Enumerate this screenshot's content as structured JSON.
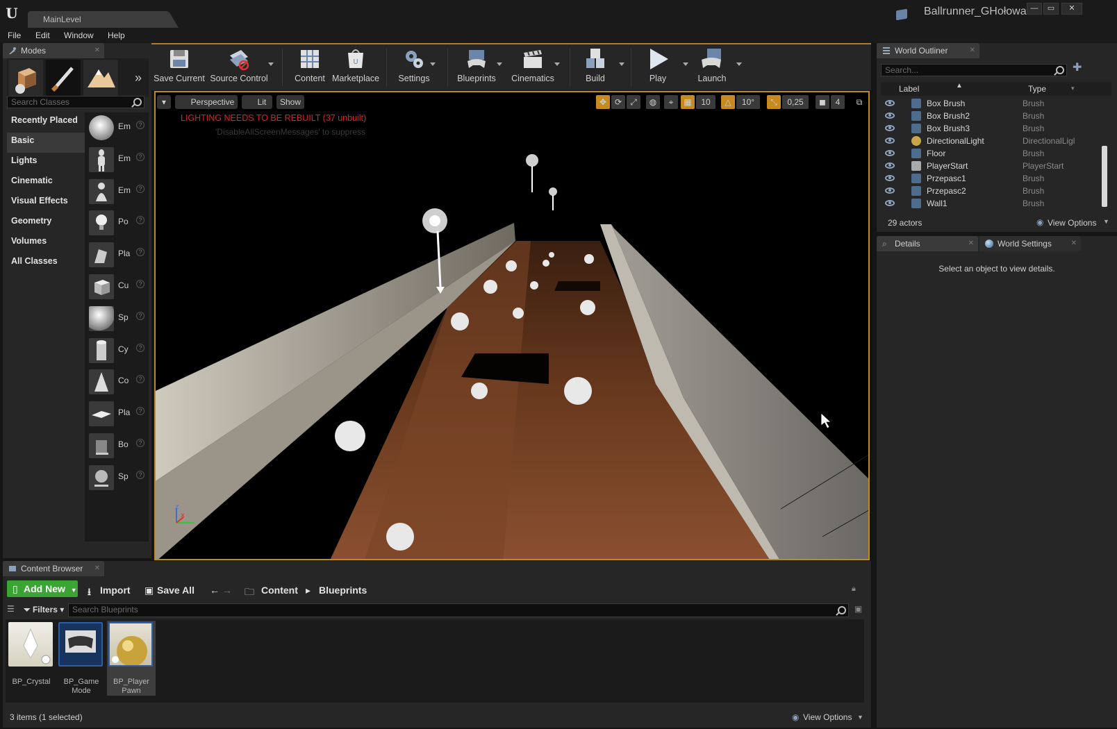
{
  "window": {
    "level_tab": "MainLevel",
    "project_name": "Ballrunner_GHołowacz",
    "controls": [
      "—",
      "▭",
      "✕"
    ]
  },
  "menu": [
    "File",
    "Edit",
    "Window",
    "Help"
  ],
  "modes": {
    "title": "Modes",
    "search_placeholder": "Search Classes",
    "categories": [
      "Recently Placed",
      "Basic",
      "Lights",
      "Cinematic",
      "Visual Effects",
      "Geometry",
      "Volumes",
      "All Classes"
    ],
    "active_category": "Basic",
    "items": [
      "Em",
      "Em",
      "Em",
      "Po",
      "Pla",
      "Cu",
      "Sp",
      "Cy",
      "Co",
      "Pla",
      "Bo",
      "Sp"
    ]
  },
  "toolbar": {
    "buttons": [
      "Save Current",
      "Source Control",
      "Content",
      "Marketplace",
      "Settings",
      "Blueprints",
      "Cinematics",
      "Build",
      "Play",
      "Launch"
    ]
  },
  "viewport": {
    "perspective": "Perspective",
    "lit": "Lit",
    "show": "Show",
    "warning": "LIGHTING NEEDS TO BE REBUILT (37 unbuilt)",
    "suppress": "'DisableAllScreenMessages' to suppress",
    "grid_snap": "10",
    "rotation_snap": "10°",
    "scale_snap": "0,25",
    "camera_speed": "4"
  },
  "outliner": {
    "title": "World Outliner",
    "search_placeholder": "Search...",
    "col_label": "Label",
    "col_type": "Type",
    "rows": [
      {
        "label": "Box Brush",
        "type": "Brush"
      },
      {
        "label": "Box Brush2",
        "type": "Brush"
      },
      {
        "label": "Box Brush3",
        "type": "Brush"
      },
      {
        "label": "DirectionalLight",
        "type": "DirectionalLigl"
      },
      {
        "label": "Floor",
        "type": "Brush"
      },
      {
        "label": "PlayerStart",
        "type": "PlayerStart"
      },
      {
        "label": "Przepasc1",
        "type": "Brush"
      },
      {
        "label": "Przepasc2",
        "type": "Brush"
      },
      {
        "label": "Wall1",
        "type": "Brush"
      }
    ],
    "count": "29 actors",
    "view_options": "View Options"
  },
  "details": {
    "tab": "Details",
    "world_settings_tab": "World Settings",
    "empty_message": "Select an object to view details."
  },
  "content_browser": {
    "title": "Content Browser",
    "add_new": "Add New",
    "import": "Import",
    "save_all": "Save All",
    "path": [
      "Content",
      "Blueprints"
    ],
    "filters": "Filters",
    "search_placeholder": "Search Blueprints",
    "assets": [
      {
        "name": "BP_Crystal"
      },
      {
        "name": "BP_Game Mode"
      },
      {
        "name": "BP_Player Pawn"
      }
    ],
    "status": "3 items (1 selected)",
    "view_options": "View Options"
  }
}
